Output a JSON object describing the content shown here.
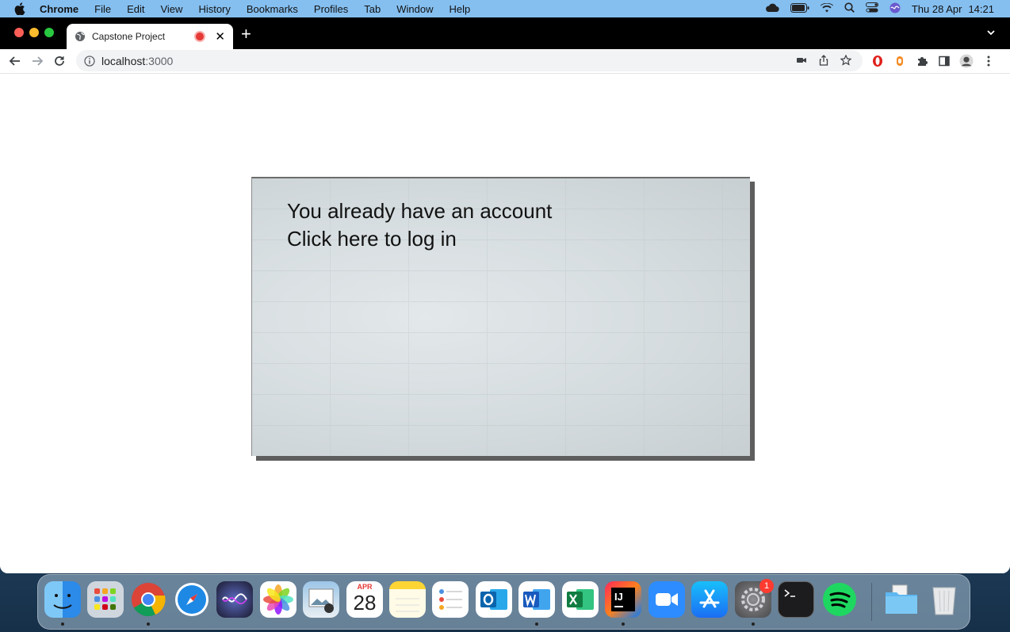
{
  "menubar": {
    "app_name": "Chrome",
    "items": [
      "File",
      "Edit",
      "View",
      "History",
      "Bookmarks",
      "Profiles",
      "Tab",
      "Window",
      "Help"
    ],
    "date": "Thu 28 Apr",
    "time": "14:21"
  },
  "browser": {
    "tab_title": "Capstone Project",
    "url_host": "localhost",
    "url_port": ":3000"
  },
  "page": {
    "line1": "You already have an account",
    "line2": "Click here to log in"
  },
  "dock": {
    "calendar_month": "APR",
    "calendar_day": "28",
    "settings_badge": "1",
    "apps": [
      "Finder",
      "Launchpad",
      "Chrome",
      "Safari",
      "Siri",
      "Photos",
      "Preview",
      "Calendar",
      "Notes",
      "Reminders",
      "Outlook",
      "Word",
      "Excel",
      "IntelliJ IDEA",
      "Zoom",
      "App Store",
      "System Preferences",
      "Terminal",
      "Spotify",
      "Downloads",
      "Trash"
    ]
  },
  "colors": {
    "menubar_bg": "#85bff0",
    "tabstrip_bg": "#000000",
    "card_bg": "#d5dcdf",
    "recording_red": "#e53935"
  }
}
